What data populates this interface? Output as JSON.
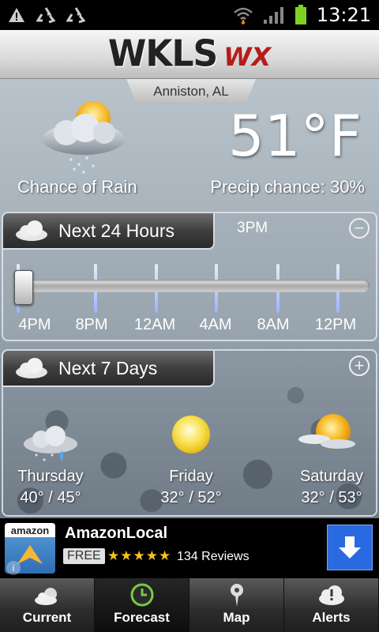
{
  "status_bar": {
    "time": "13:21",
    "left_icons": [
      "warning-icon",
      "recycle-icon",
      "recycle-icon"
    ],
    "right_icons": [
      "wifi-icon",
      "signal-icon",
      "battery-icon"
    ]
  },
  "header": {
    "logo_main": "WKLS",
    "logo_sub": "WX",
    "location": "Anniston, AL"
  },
  "current": {
    "temperature": "51°F",
    "condition": "Chance of Rain",
    "precip_chance": "Precip chance: 30%"
  },
  "next24": {
    "title": "Next 24 Hours",
    "now_label": "3PM",
    "toggle_symbol": "−",
    "ticks": [
      "4PM",
      "8PM",
      "12AM",
      "4AM",
      "8AM",
      "12PM"
    ]
  },
  "next7": {
    "title": "Next 7 Days",
    "toggle_symbol": "+",
    "days": [
      {
        "name": "Thursday",
        "temps": "40° / 45°",
        "icon": "rain-cloud-icon"
      },
      {
        "name": "Friday",
        "temps": "32° / 52°",
        "icon": "sun-icon"
      },
      {
        "name": "Saturday",
        "temps": "32° / 53°",
        "icon": "partly-sunny-icon"
      }
    ]
  },
  "ad": {
    "logo_text": "amazon",
    "title": "AmazonLocal",
    "price": "FREE",
    "stars": "★★★★★",
    "rating": 4.5,
    "reviews": "134 Reviews"
  },
  "nav": {
    "items": [
      {
        "label": "Current",
        "icon": "cloud-icon"
      },
      {
        "label": "Forecast",
        "icon": "clock-icon"
      },
      {
        "label": "Map",
        "icon": "map-pin-icon"
      },
      {
        "label": "Alerts",
        "icon": "alert-cloud-icon"
      }
    ],
    "active": "Forecast"
  },
  "colors": {
    "logo_red": "#b61c1c",
    "ad_button": "#2a6ae0",
    "tick_blue": "#9ab4ff"
  }
}
